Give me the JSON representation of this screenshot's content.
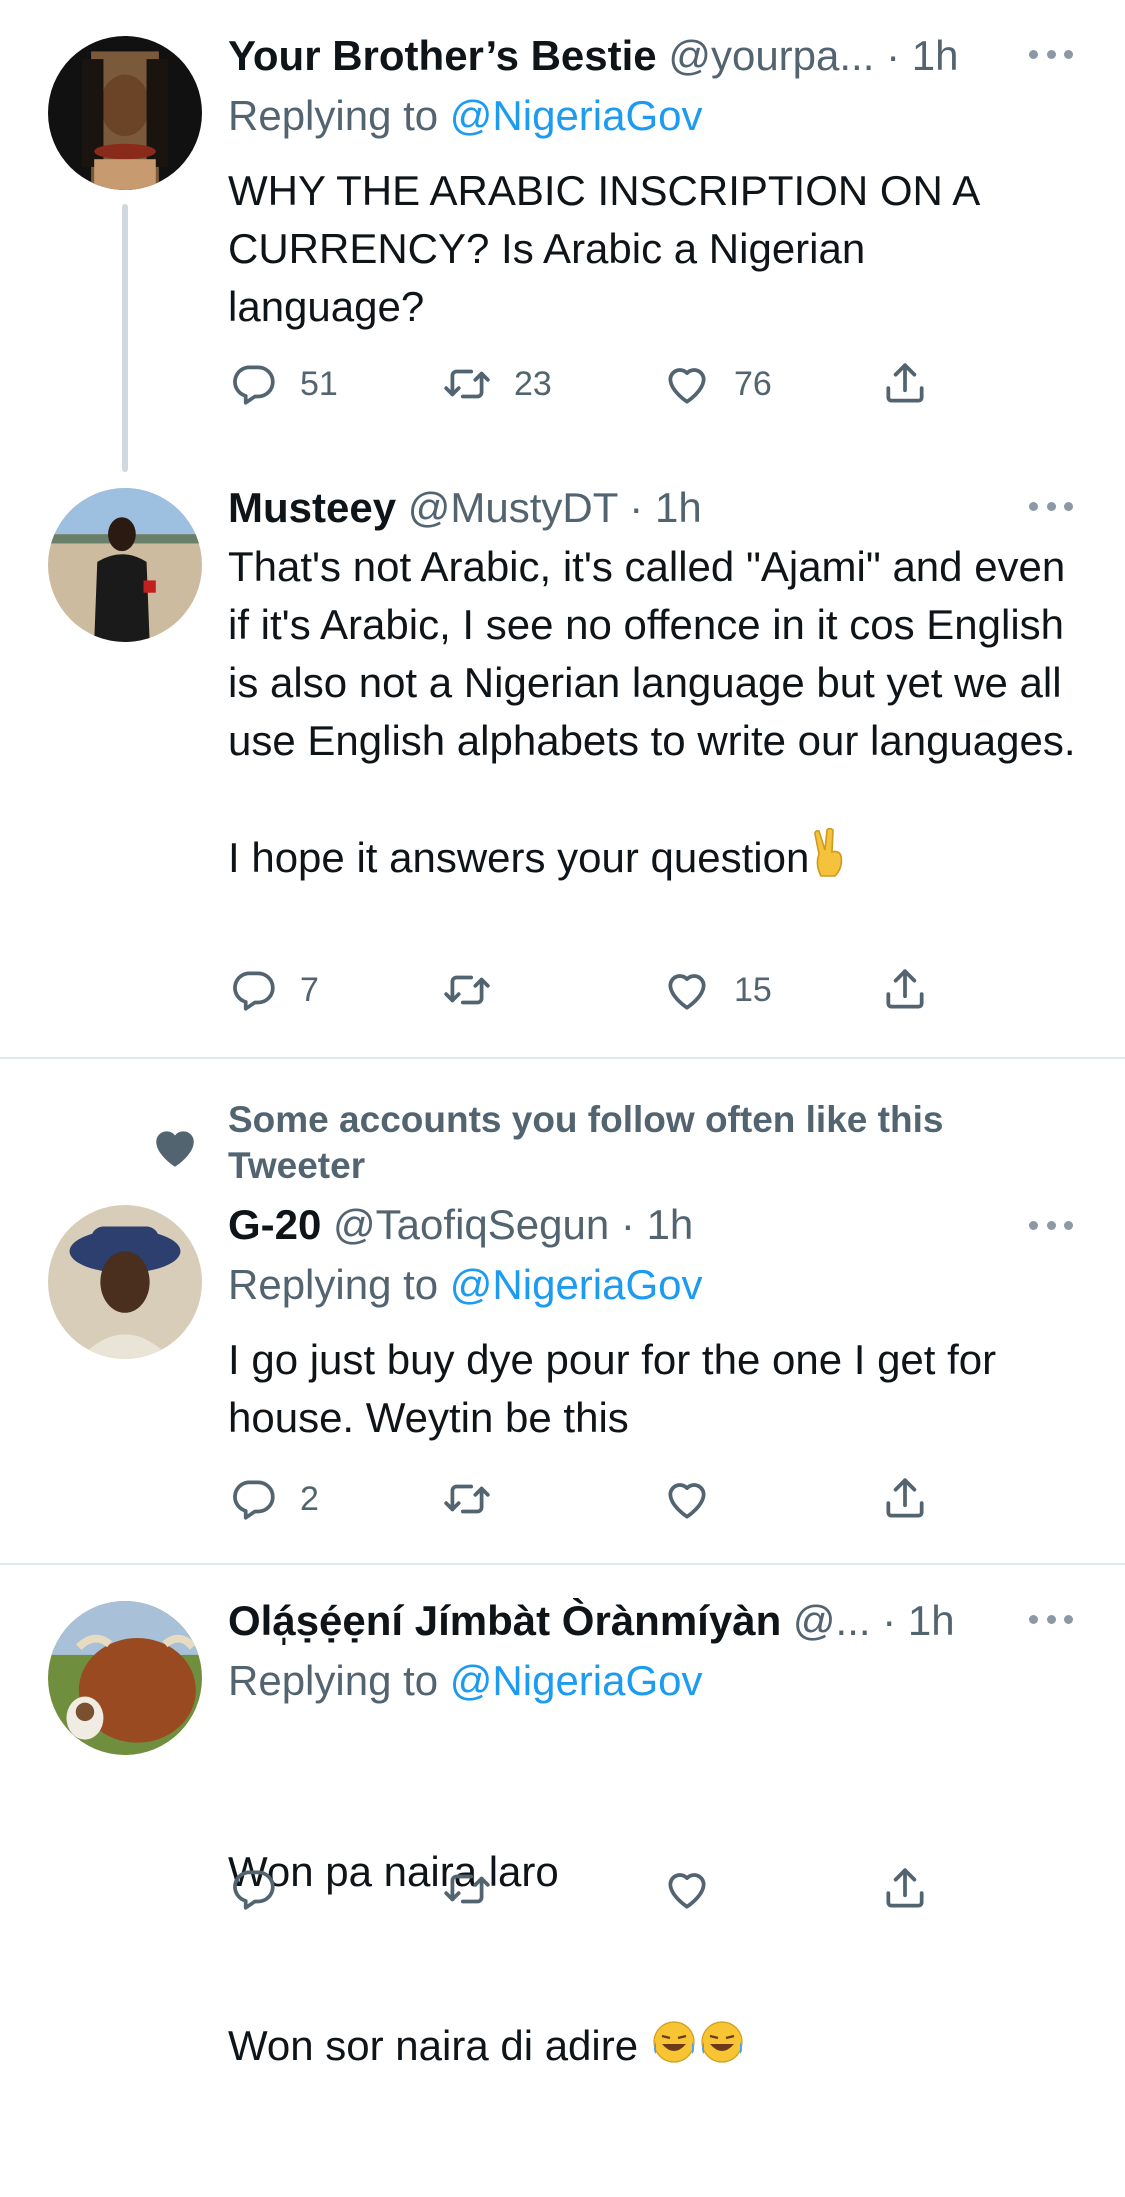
{
  "tweets": [
    {
      "name": "Your Brother’s Bestie",
      "handle": "@yourpa...",
      "dot": "·",
      "time": "1h",
      "replying_label": "Replying to",
      "replying_to": "@NigeriaGov",
      "text": "WHY THE ARABIC INSCRIPTION ON A CURRENCY? Is Arabic a Nigerian language?",
      "replies": "51",
      "retweets": "23",
      "likes": "76"
    },
    {
      "name": "Musteey",
      "handle": "@MustyDT",
      "dot": "·",
      "time": "1h",
      "text": "That's not Arabic, it's called \"Ajami\" and even if it's Arabic, I see no offence in it cos English is also not a Nigerian language but yet we all use English alphabets to write our languages.\n\nI hope it answers your question",
      "replies": "7",
      "retweets": "",
      "likes": "15"
    },
    {
      "social_context": "Some accounts you follow often like this Tweeter",
      "name": "G-20",
      "handle": "@TaofiqSegun",
      "dot": "·",
      "time": "1h",
      "replying_label": "Replying to",
      "replying_to": "@NigeriaGov",
      "text": "I go just buy dye pour for the one I get for house. Weytin be this",
      "replies": "2",
      "retweets": "",
      "likes": ""
    },
    {
      "name": "Olá̩ṣẹ́ẹní Jímbàt Òrànmíyàn",
      "handle": "@...",
      "dot": "·",
      "time": "1h",
      "replying_label": "Replying to",
      "replying_to": "@NigeriaGov",
      "text_line1": "Won pa naira laro",
      "text_line2": "Won sor naira di adire"
    }
  ],
  "icons": {
    "reply": "reply-icon",
    "retweet": "retweet-icon",
    "like": "heart-icon",
    "share": "share-icon",
    "more": "more-options-icon",
    "social": "heart-filled-icon"
  },
  "colors": {
    "link": "#1d9bf0",
    "secondary_text": "#536471",
    "thread_line": "#cfd9de"
  }
}
